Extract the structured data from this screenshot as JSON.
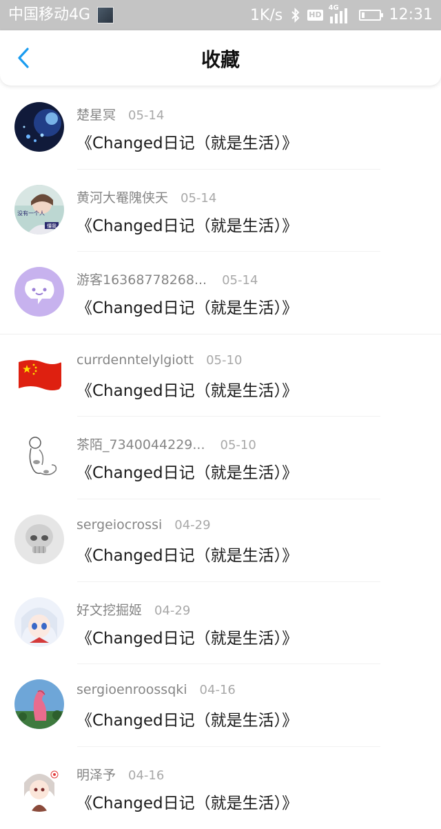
{
  "status_bar": {
    "carrier": "中国移动4G",
    "speed": "1K/s",
    "hd": "HD",
    "network": "4G",
    "battery_level": 0.2,
    "time": "12:31"
  },
  "header": {
    "title": "收藏",
    "back_icon": "chevron-left-icon",
    "accent_color": "#1a9cf0"
  },
  "items": [
    {
      "user": "楚星冥",
      "date": "05-14",
      "title": "《Changed日记（就是生活）》"
    },
    {
      "user": "黄河大罨隗侠天",
      "date": "05-14",
      "title": "《Changed日记（就是生活）》"
    },
    {
      "user": "游客16368778268...",
      "date": "05-14",
      "title": "《Changed日记（就是生活）》"
    },
    {
      "user": "currdenntelylgiott",
      "date": "05-10",
      "title": "《Changed日记（就是生活）》"
    },
    {
      "user": "茶陌_7340044229...",
      "date": "05-10",
      "title": "《Changed日记（就是生活）》"
    },
    {
      "user": "sergeiocrossi",
      "date": "04-29",
      "title": "《Changed日记（就是生活）》"
    },
    {
      "user": "好文挖掘姬",
      "date": "04-29",
      "title": "《Changed日记（就是生活）》"
    },
    {
      "user": "sergioenroossqki",
      "date": "04-16",
      "title": "《Changed日记（就是生活）》"
    },
    {
      "user": "明泽予",
      "date": "04-16",
      "title": "《Changed日记（就是生活）》"
    }
  ],
  "avatar_texts": {
    "item2_line1": "没有一个人",
    "item2_line2": "懂我"
  }
}
